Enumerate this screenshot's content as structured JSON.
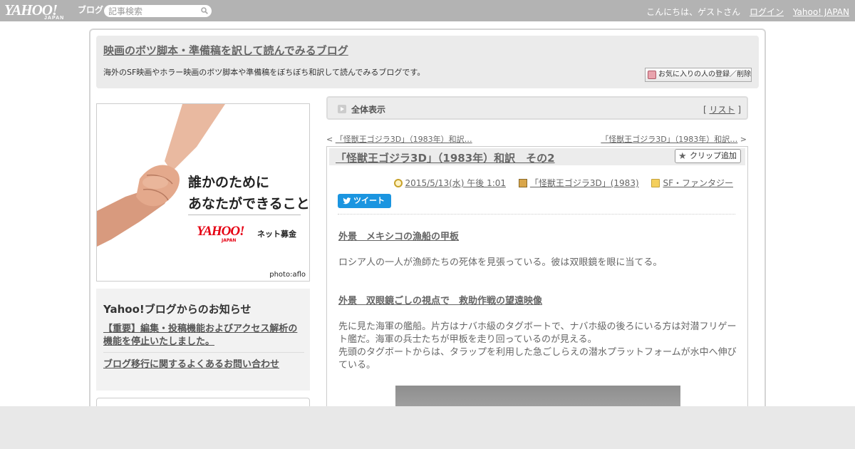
{
  "topbar": {
    "logo_text": "YAHOO!",
    "logo_sub": "JAPAN",
    "logo_blog": "ブログ",
    "search_placeholder": "記事検索",
    "greeting": "こんにちは、ゲストさん",
    "login": "ログイン",
    "yahoo_japan": "Yahoo! JAPAN"
  },
  "header": {
    "title": "映画のボツ脚本・準備稿を訳して読んでみるブログ",
    "description": "海外のSF映画やホラー映画のボツ脚本や準備稿をぼちぼち和訳して読んでみるブログです。",
    "fav_button": "お気に入りの人の登録／削除"
  },
  "banner": {
    "line1": "誰かのために",
    "line2": "あなたができること",
    "logo": "YAHOO!",
    "logo_sub": "JAPAN",
    "campaign": "ネット募金",
    "credit": "photo:aflo"
  },
  "notice": {
    "title": "Yahoo!ブログからのお知らせ",
    "items": [
      "【重要】編集・投稿機能およびアクセス解析の機能を停止いたしました。",
      "ブログ移行に関するよくあるお問い合わせ"
    ]
  },
  "nav": {
    "all_view": "全体表示",
    "list_open": "[ ",
    "list": "リスト",
    "list_close": " ]",
    "prev_mark": "< ",
    "prev": "「怪獣王ゴジラ3D」（1983年）和訳…",
    "next": "「怪獣王ゴジラ3D」（1983年）和訳…",
    "next_mark": " >"
  },
  "article": {
    "title": "「怪獣王ゴジラ3D」（1983年）和訳　その2",
    "clip_button": "クリップ追加",
    "date": "2015/5/13(水) 午後 1:01",
    "book": "「怪獣王ゴジラ3D」(1983)",
    "category": "SF・ファンタジー",
    "tweet": "ツイート",
    "heading1": "外景　メキシコの漁船の甲板",
    "para1": "ロシア人の一人が漁師たちの死体を見張っている。彼は双眼鏡を眼に当てる。",
    "heading2": "外景　双眼鏡ごしの視点で　救助作戦の望遠映像",
    "para2": "先に見た海軍の艦船。片方はナバホ級のタグボートで、ナバホ級の後ろにいる方は対潜フリゲート艦だ。海軍の兵士たちが甲板を走り回っているのが見える。",
    "para3": "先頭のタグボートからは、タラップを利用した急ごしらえの潜水プラットフォームが水中へ伸びている。"
  },
  "colors": {
    "topbar": "#b3b3b3",
    "tweet": "#1b95e0",
    "yahoo_red": "#e60012"
  }
}
